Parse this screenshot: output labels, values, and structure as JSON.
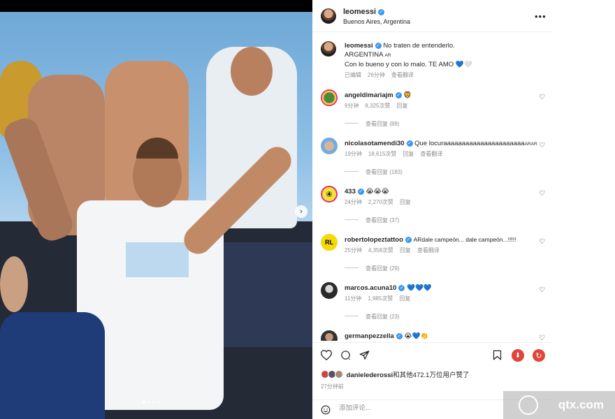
{
  "post": {
    "username": "leomessi",
    "location": "Buenos Aires, Argentina",
    "caption_line1": "No traten de entenderlo.",
    "caption_line2": "ARGENTINA",
    "caption_flag": "AR",
    "caption_line3": "Con lo bueno y con lo malo. TE AMO",
    "caption_emoji": "💙🤍",
    "caption_edited": "已编辑",
    "caption_time": "26分钟",
    "caption_translate": "查看翻译"
  },
  "comments": [
    {
      "user": "angeldimariajm",
      "text": "",
      "emoji": "🦁",
      "time": "9分钟",
      "likes": "8,325次赞",
      "reply": "回复",
      "translate": "",
      "replies": "查看回复 (89)"
    },
    {
      "user": "nicolasotamendi30",
      "text": "Que locuraaaaaaaaaaaaaaaaaaaaaa",
      "emoji": "ARAR",
      "time": "19分钟",
      "likes": "18,615次赞",
      "reply": "回复",
      "translate": "查看翻译",
      "replies": "查看回复 (183)"
    },
    {
      "user": "433",
      "text": "",
      "emoji": "😭😭😭",
      "time": "24分钟",
      "likes": "2,270次赞",
      "reply": "回复",
      "translate": "",
      "replies": "查看回复 (37)"
    },
    {
      "user": "robertolopeztattoo",
      "text": "ARdale campeón... dale campeón...!!!!!",
      "emoji": "",
      "time": "25分钟",
      "likes": "4,358次赞",
      "reply": "回复",
      "translate": "查看翻译",
      "replies": "查看回复 (29)"
    },
    {
      "user": "marcos.acuna10",
      "text": "",
      "emoji": "💙💙💙",
      "time": "11分钟",
      "likes": "1,985次赞",
      "reply": "回复",
      "translate": "",
      "replies": "查看回复 (23)"
    },
    {
      "user": "germanpezzella",
      "text": "",
      "emoji": "😭💙👏",
      "time": "",
      "likes": "",
      "reply": "",
      "translate": "",
      "replies": ""
    }
  ],
  "likes_text_user": "danielederossi",
  "likes_text_rest": "和其他472.1万位用户赞了",
  "post_time": "27分钟前",
  "add_comment_placeholder": "添加评论...",
  "watermark": "qtx.com",
  "colors": {
    "verified": "#3897f0",
    "text": "#262626",
    "secondary": "#8e8e8e",
    "red_icon": "#e0453a"
  }
}
